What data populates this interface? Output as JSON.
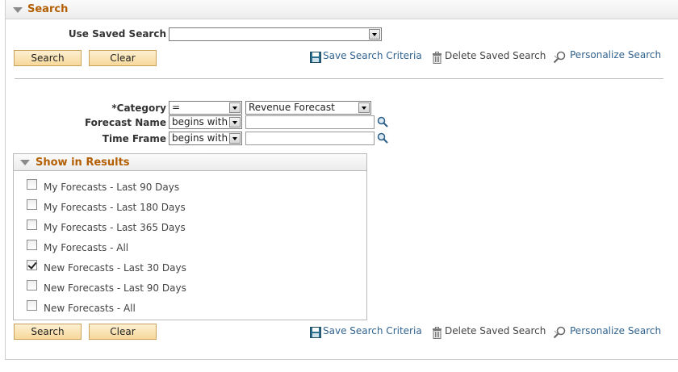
{
  "search_section": {
    "title": "Search"
  },
  "saved_search": {
    "label": "Use Saved Search",
    "value": ""
  },
  "toolbar_top": {
    "search_label": "Search",
    "clear_label": "Clear",
    "save_criteria": "Save Search Criteria",
    "delete_saved": "Delete Saved Search",
    "personalize": "Personalize Search"
  },
  "criteria": {
    "category": {
      "label": "*Category",
      "operator": "=",
      "value": "Revenue Forecast"
    },
    "forecast_name": {
      "label": "Forecast Name",
      "operator": "begins with",
      "value": ""
    },
    "time_frame": {
      "label": "Time Frame",
      "operator": "begins with",
      "value": ""
    }
  },
  "results": {
    "title": "Show in Results",
    "options": [
      {
        "label": "My Forecasts - Last 90 Days",
        "checked": false
      },
      {
        "label": "My Forecasts - Last 180 Days",
        "checked": false
      },
      {
        "label": "My Forecasts - Last 365 Days",
        "checked": false
      },
      {
        "label": "My Forecasts - All",
        "checked": false
      },
      {
        "label": "New Forecasts - Last 30 Days",
        "checked": true
      },
      {
        "label": "New Forecasts - Last 90 Days",
        "checked": false
      },
      {
        "label": "New Forecasts - All",
        "checked": false
      }
    ]
  },
  "toolbar_bottom": {
    "search_label": "Search",
    "clear_label": "Clear",
    "save_criteria": "Save Search Criteria",
    "delete_saved": "Delete Saved Search",
    "personalize": "Personalize Search"
  },
  "colors": {
    "header_title": "#b35e00",
    "link": "#31638f",
    "button_fill": "#f7d89a"
  }
}
